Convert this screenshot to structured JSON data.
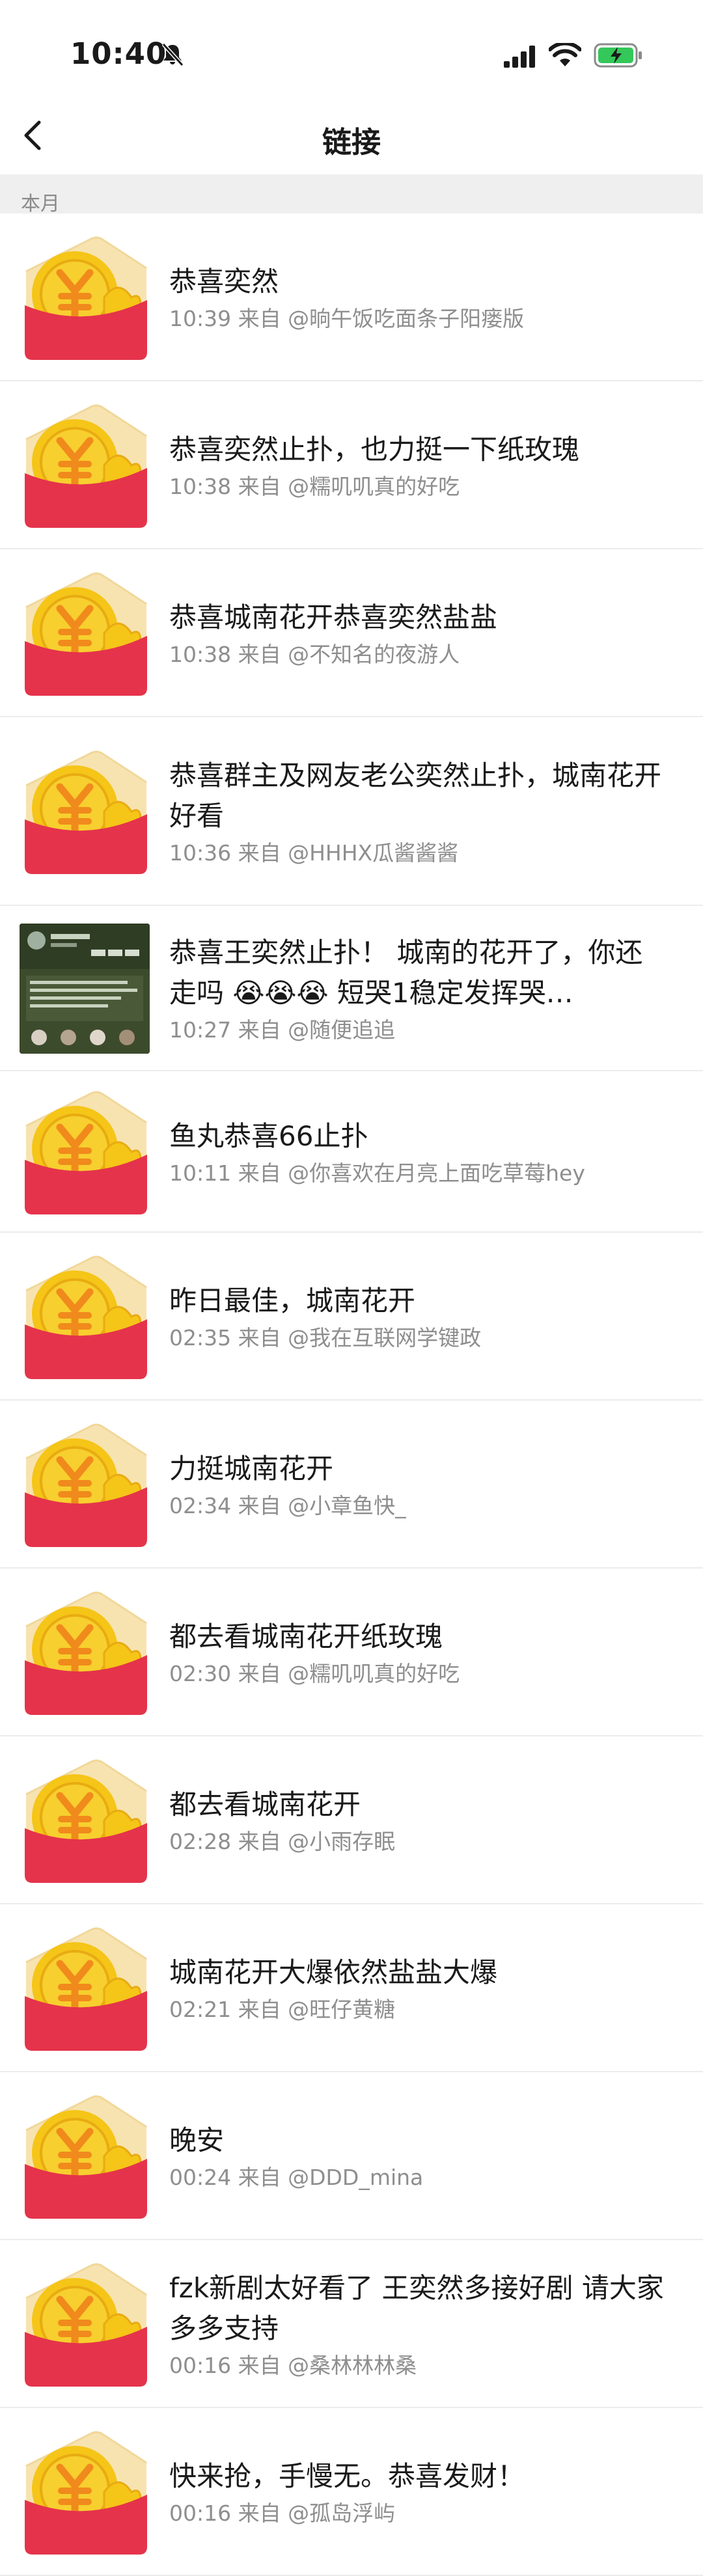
{
  "status_bar": {
    "time": "10:40"
  },
  "nav": {
    "title": "链接"
  },
  "section": {
    "label": "本月"
  },
  "items": [
    {
      "title": "恭喜奕然",
      "time": "10:39",
      "source": "来自 @晌午饭吃面条子阳瘘版"
    },
    {
      "title": "恭喜奕然止扑，也力挺一下纸玫瑰",
      "time": "10:38",
      "source": "来自 @糯叽叽真的好吃"
    },
    {
      "title": "恭喜城南花开恭喜奕然盐盐",
      "time": "10:38",
      "source": "来自 @不知名的夜游人"
    },
    {
      "title": "恭喜群主及网友老公奕然止扑，城南花开好看",
      "time": "10:36",
      "source": "来自 @HHHX瓜酱酱酱"
    },
    {
      "title": "恭喜王奕然止扑！ 城南的花开了，你还走吗 😭😭😭 短哭1稳定发挥哭…",
      "time": "10:27",
      "source": "来自 @随便追追"
    },
    {
      "title": "鱼丸恭喜66止扑",
      "time": "10:11",
      "source": "来自 @你喜欢在月亮上面吃草莓hey"
    },
    {
      "title": "昨日最佳，城南花开",
      "time": "02:35",
      "source": "来自 @我在互联网学键政"
    },
    {
      "title": "力挺城南花开",
      "time": "02:34",
      "source": "来自 @小章鱼快_"
    },
    {
      "title": "都去看城南花开纸玫瑰",
      "time": "02:30",
      "source": "来自 @糯叽叽真的好吃"
    },
    {
      "title": "都去看城南花开",
      "time": "02:28",
      "source": "来自 @小雨存眠"
    },
    {
      "title": "城南花开大爆依然盐盐大爆",
      "time": "02:21",
      "source": "来自 @旺仔黄糖"
    },
    {
      "title": "晚安",
      "time": "00:24",
      "source": "来自 @DDD_mina"
    },
    {
      "title": "fzk新剧太好看了 王奕然多接好剧 请大家多多支持",
      "time": "00:16",
      "source": "来自 @桑林林林桑"
    },
    {
      "title": "快来抢，手慢无。恭喜发财！",
      "time": "00:16",
      "source": "来自 @孤岛浮屿"
    }
  ],
  "icons": {
    "red_envelope": "red-envelope-icon",
    "back": "chevron-left-icon"
  },
  "colors": {
    "envelope_red": "#e5334b",
    "envelope_flap": "#f7e3b0",
    "coin_yellow": "#f5c518",
    "coin_orange": "#f08a1c",
    "section_bg": "#efefef",
    "battery_green": "#34c759"
  }
}
